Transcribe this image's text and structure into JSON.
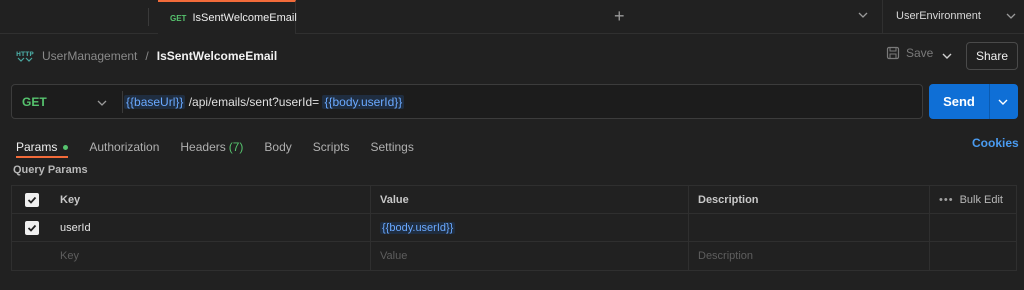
{
  "tab": {
    "method": "GET",
    "name": "IsSentWelcomeEmail"
  },
  "environment": {
    "name": "UserEnvironment"
  },
  "breadcrumb": {
    "parent": "UserManagement",
    "separator": "/",
    "current": "IsSentWelcomeEmail"
  },
  "toolbar": {
    "save_label": "Save",
    "share_label": "Share"
  },
  "request": {
    "method": "GET",
    "url_parts": {
      "var1": "{{baseUrl}}",
      "path": " /api/emails/sent?userId= ",
      "var2": "{{body.userId}}"
    },
    "send_label": "Send"
  },
  "request_tabs": {
    "params": "Params",
    "authorization": "Authorization",
    "headers": "Headers",
    "headers_count": "(7)",
    "body": "Body",
    "scripts": "Scripts",
    "settings": "Settings",
    "cookies": "Cookies"
  },
  "query_params": {
    "title": "Query Params",
    "columns": {
      "key": "Key",
      "value": "Value",
      "description": "Description",
      "bulk_edit": "Bulk Edit"
    },
    "rows": [
      {
        "key": "userId",
        "value": "{{body.userId}}",
        "description": ""
      }
    ],
    "placeholder": {
      "key": "Key",
      "value": "Value",
      "description": "Description"
    }
  },
  "colors": {
    "accent": "#f26b3a",
    "send": "#0f6fd6",
    "get": "#56c36e",
    "variable": "#6aa9ff",
    "link": "#4a9bf0"
  }
}
